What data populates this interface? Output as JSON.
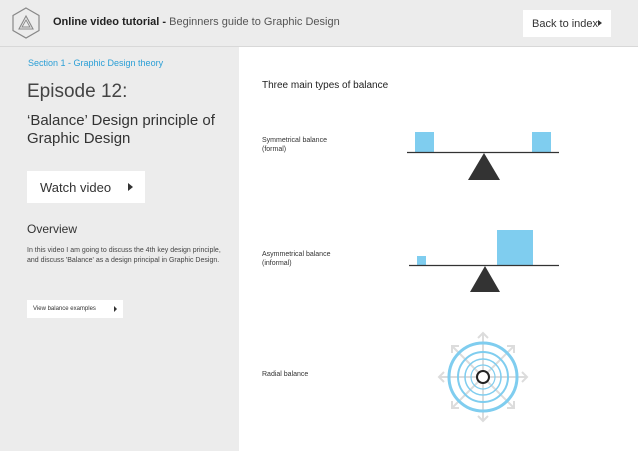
{
  "header": {
    "title_bold": "Online video tutorial -",
    "title_light": "Beginners guide to Graphic Design",
    "back_label": "Back to index"
  },
  "sidebar": {
    "section_label": "Section 1 - Graphic Design theory",
    "episode": "Episode 12:",
    "subtitle": "‘Balance’ Design principle of Graphic Design",
    "watch_label": "Watch video",
    "overview_title": "Overview",
    "overview_text": "In this video I am going to discuss the 4th key design principle, and discuss 'Balance' as a design principal in Graphic Design.",
    "examples_label": "View balance examples"
  },
  "main": {
    "title": "Three main types of balance",
    "symmetrical_label": "Symmetrical balance (formal)",
    "asymmetrical_label": "Asymmetrical balance (informal)",
    "radial_label": "Radial balance"
  },
  "colors": {
    "accent_blue": "#2b9fd6",
    "block_blue": "#7fcdef",
    "panel_grey": "#ececec",
    "fulcrum": "#333333"
  }
}
